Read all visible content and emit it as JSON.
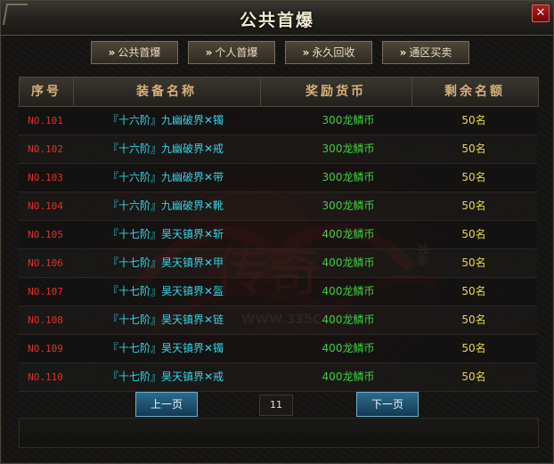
{
  "window": {
    "title": "公共首爆",
    "close_glyph": "✕"
  },
  "tabs": [
    {
      "label": "公共首爆"
    },
    {
      "label": "个人首爆"
    },
    {
      "label": "永久回收"
    },
    {
      "label": "通区买卖"
    }
  ],
  "tab_chevron": "»",
  "table": {
    "headers": [
      "序号",
      "装备名称",
      "奖励货币",
      "剩余名额"
    ],
    "rows": [
      {
        "no": "NO.101",
        "name": "『十六阶』九幽破界✕镯",
        "reward": "300龙鳞币",
        "remain": "50名"
      },
      {
        "no": "NO.102",
        "name": "『十六阶』九幽破界✕戒",
        "reward": "300龙鳞币",
        "remain": "50名"
      },
      {
        "no": "NO.103",
        "name": "『十六阶』九幽破界✕带",
        "reward": "300龙鳞币",
        "remain": "50名"
      },
      {
        "no": "NO.104",
        "name": "『十六阶』九幽破界✕靴",
        "reward": "300龙鳞币",
        "remain": "50名"
      },
      {
        "no": "NO.105",
        "name": "『十七阶』昊天镇界✕斩",
        "reward": "400龙鳞币",
        "remain": "50名"
      },
      {
        "no": "NO.106",
        "name": "『十七阶』昊天镇界✕甲",
        "reward": "400龙鳞币",
        "remain": "50名"
      },
      {
        "no": "NO.107",
        "name": "『十七阶』昊天镇界✕盔",
        "reward": "400龙鳞币",
        "remain": "50名"
      },
      {
        "no": "NO.108",
        "name": "『十七阶』昊天镇界✕链",
        "reward": "400龙鳞币",
        "remain": "50名"
      },
      {
        "no": "NO.109",
        "name": "『十七阶』昊天镇界✕镯",
        "reward": "400龙鳞币",
        "remain": "50名"
      },
      {
        "no": "NO.110",
        "name": "『十七阶』昊天镇界✕戒",
        "reward": "400龙鳞币",
        "remain": "50名"
      }
    ]
  },
  "pager": {
    "prev": "上一页",
    "page": "11",
    "next": "下一页"
  },
  "watermark": {
    "logo_text": "传奇",
    "side_text": "独家",
    "url": "WWW.335C"
  },
  "colors": {
    "number": "#e0302a",
    "item_name": "#32d4e6",
    "reward": "#3cd23c",
    "remain": "#e6d84a",
    "header": "#d8b07a"
  }
}
